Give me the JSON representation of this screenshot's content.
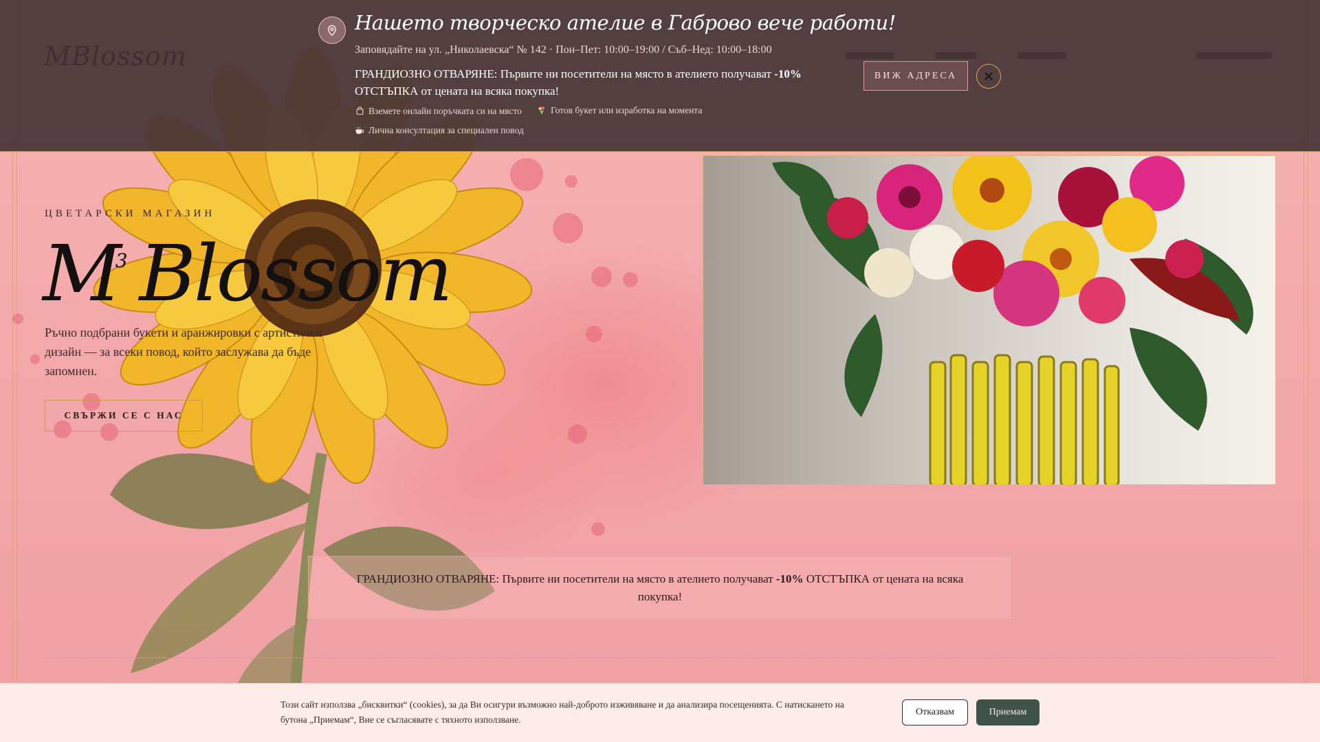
{
  "announcement": {
    "title": "Нашето творческо ателие в Габрово вече работи!",
    "address": "Заповядайте на ул. „Николаевска“ № 142 · Пон–Пет: 10:00–19:00 / Съб–Нед: 10:00–18:00",
    "promo_prefix": "ГРАНДИОЗНО ОТВАРЯНЕ: Първите ни посетители на място в ателието получават ",
    "promo_discount": "-10%",
    "promo_suffix": " ОТСТЪПКА от цената на всяка покупка!",
    "features": [
      {
        "icon": "bag-icon",
        "label": "Вземете онлайн поръчката си на място"
      },
      {
        "icon": "bouquet-icon",
        "label": "Готов букет или изработка на момента"
      },
      {
        "icon": "coffee-icon",
        "label": "Лична консултация за специален повод"
      }
    ],
    "address_button": "ВИЖ АДРЕСА"
  },
  "hero": {
    "eyebrow": "ЦВЕТАРСКИ МАГАЗИН",
    "brand_main": "M",
    "brand_sup": "3",
    "brand_rest": "Blossom",
    "description": "Ръчно подбрани букети и аранжировки с артистичен дизайн — за всеки повод, който заслужава да бъде запомнен.",
    "cta": "СВЪРЖИ СЕ С НАС"
  },
  "promo_box": {
    "prefix": "ГРАНДИОЗНО ОТВАРЯНЕ: Първите ни посетители на място в ателието получават ",
    "discount": "-10%",
    "suffix": " ОТСТЪПКА от цената на всяка покупка!"
  },
  "cookie": {
    "text": "Този сайт използва „бисквитки“ (cookies), за да Ви осигури възможно най-доброто изживяване и да анализира посещенията. С натискането на бутона „Приемам“, Вие се съгласявате с тяхното използване.",
    "decline": "Отказвам",
    "accept": "Приемам"
  },
  "colors": {
    "announcement_bg": "#483638",
    "accent_gold": "#d9a65a",
    "page_pink": "#f1a9ab",
    "accept_green": "#3f5247"
  }
}
